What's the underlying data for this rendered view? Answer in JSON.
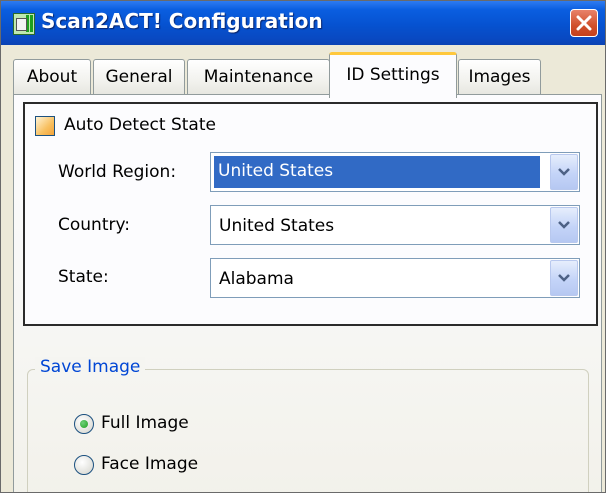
{
  "window": {
    "title": "Scan2ACT! Configuration",
    "icon": "scanner-app-icon",
    "close_icon": "close-icon"
  },
  "tabs": [
    {
      "label": "About"
    },
    {
      "label": "General"
    },
    {
      "label": "Maintenance"
    },
    {
      "label": "ID Settings",
      "active": true
    },
    {
      "label": "Images"
    }
  ],
  "id_settings": {
    "auto_detect_label": "Auto Detect State",
    "auto_detect_checked": false,
    "world_region": {
      "label": "World Region:",
      "value": "United States"
    },
    "country": {
      "label": "Country:",
      "value": "United States"
    },
    "state": {
      "label": "State:",
      "value": "Alabama"
    }
  },
  "save_image": {
    "legend": "Save Image",
    "options": [
      {
        "label": "Full Image",
        "selected": true
      },
      {
        "label": "Face Image",
        "selected": false
      }
    ]
  },
  "colors": {
    "title_bar": "#0a5ee0",
    "selection": "#316ac5",
    "active_tab_accent": "#ffc83c",
    "group_legend": "#0046d5"
  }
}
